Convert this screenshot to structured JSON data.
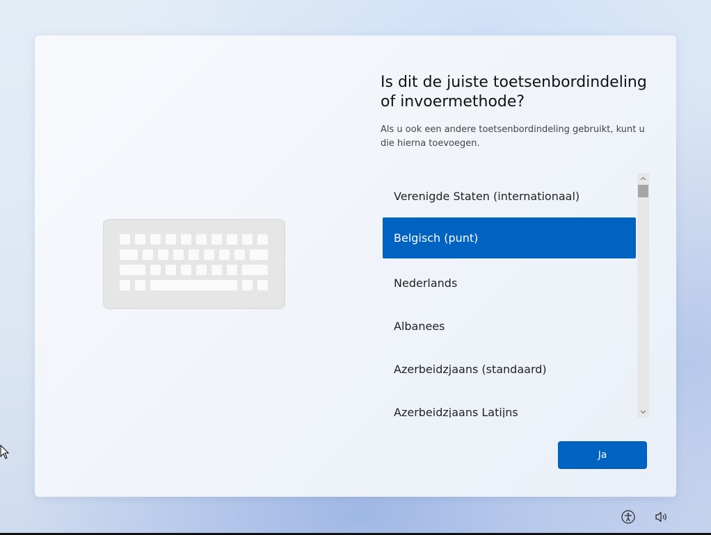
{
  "dialog": {
    "title": "Is dit de juiste toetsenbordindeling of invoermethode?",
    "subtitle": "Als u ook een andere toetsenbordindeling gebruikt, kunt u die hierna toevoegen."
  },
  "layouts": {
    "items": [
      {
        "label": "Verenigde Staten (internationaal)",
        "selected": false
      },
      {
        "label": "Belgisch (punt)",
        "selected": true
      },
      {
        "label": "Nederlands",
        "selected": false
      },
      {
        "label": "Albanees",
        "selected": false
      },
      {
        "label": "Azerbeidzjaans (standaard)",
        "selected": false
      },
      {
        "label": "Azerbeidzjaans Latijns",
        "selected": false
      }
    ]
  },
  "actions": {
    "confirm_label": "Ja"
  },
  "tray": {
    "icons": [
      "accessibility-icon",
      "volume-icon"
    ]
  },
  "colors": {
    "accent": "#0063c1",
    "selection_text": "#ffffff"
  }
}
